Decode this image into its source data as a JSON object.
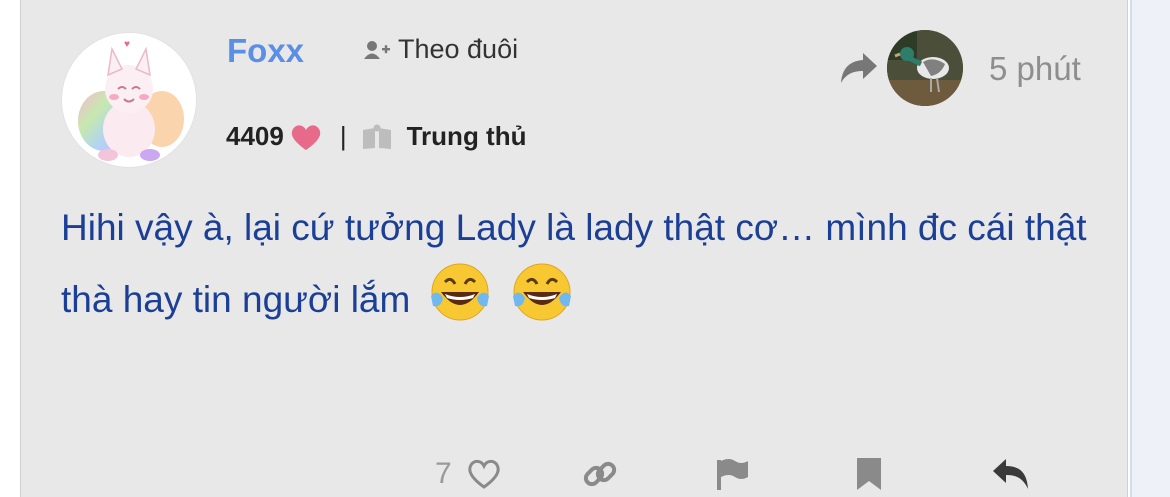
{
  "post": {
    "author": "Foxx",
    "follow_label": "Theo đuôi",
    "likes": "4409",
    "separator": "|",
    "rank": "Trung thủ",
    "time": "5 phút",
    "content": "Hihi vậy à, lại cứ tưởng Lady là lady thật cơ… mình đc cái thật thà hay tin người lắm",
    "emojis": [
      "face-with-tears-of-joy",
      "face-with-tears-of-joy"
    ]
  },
  "actions": {
    "like_count": "7",
    "icons": [
      "heart-outline-icon",
      "link-icon",
      "flag-icon",
      "bookmark-icon",
      "reply-icon"
    ]
  },
  "colors": {
    "username": "#5b8ee5",
    "content_text": "#1b3f96",
    "heart": "#e86a8a",
    "muted": "#8e8e8e",
    "post_bg": "#e8e8e8"
  }
}
